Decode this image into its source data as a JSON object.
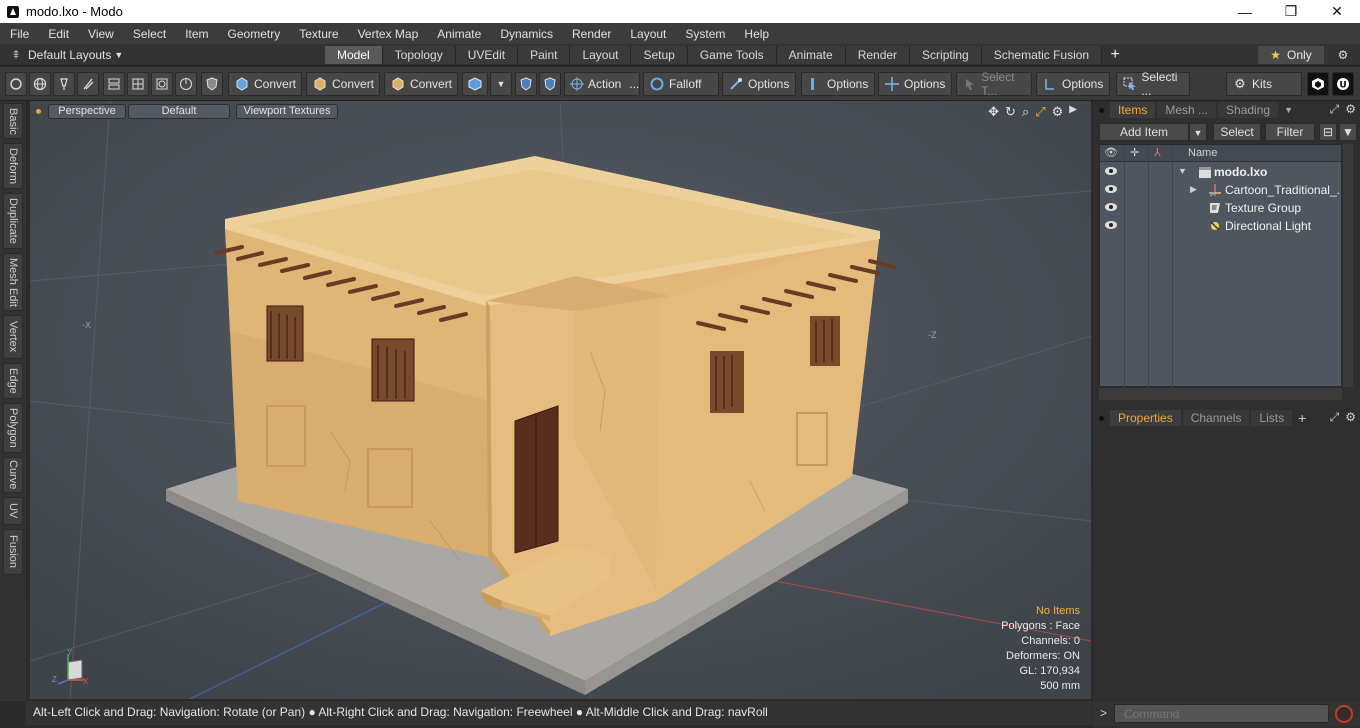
{
  "window": {
    "title": "modo.lxo - Modo",
    "minimize": "—",
    "maximize": "❐",
    "close": "✕"
  },
  "menu": [
    "File",
    "Edit",
    "View",
    "Select",
    "Item",
    "Geometry",
    "Texture",
    "Vertex Map",
    "Animate",
    "Dynamics",
    "Render",
    "Layout",
    "System",
    "Help"
  ],
  "layouts": {
    "dropdown_label": "Default Layouts",
    "tabs": [
      "Model",
      "Topology",
      "UVEdit",
      "Paint",
      "Layout",
      "Setup",
      "Game Tools",
      "Animate",
      "Render",
      "Scripting",
      "Schematic Fusion"
    ],
    "active_tab": "Model",
    "add": "+",
    "only_label": "Only"
  },
  "toolbar": {
    "convert1": "Convert",
    "convert2": "Convert",
    "convert3": "Convert",
    "action": "Action",
    "action_more": "...",
    "falloff": "Falloff",
    "options1": "Options",
    "options2": "Options",
    "options3": "Options",
    "options4": "Options",
    "select_t": "Select T...",
    "selecti": "Selecti ...",
    "kits": "Kits"
  },
  "left_tabs": [
    "Basic",
    "Deform",
    "Duplicate",
    "Mesh Edit",
    "Vertex",
    "Edge",
    "Polygon",
    "Curve",
    "UV",
    "Fusion"
  ],
  "viewport": {
    "view": "Perspective",
    "style": "Default",
    "shading": "Viewport Textures",
    "axis_x_label": "-X",
    "axis_z_label": "-Z",
    "info": {
      "selection": "No Items",
      "polygons": "Polygons : Face",
      "channels": "Channels: 0",
      "deformers": "Deformers: ON",
      "gl": "GL: 170,934",
      "scale": "500 mm"
    },
    "gizmo": {
      "y": "Y",
      "z": "Z",
      "x": "X"
    }
  },
  "status": {
    "hint1": "Alt-Left Click and Drag: Navigation: Rotate (or Pan)",
    "hint2": "Alt-Right Click and Drag: Navigation: Freewheel",
    "hint3": "Alt-Middle Click and Drag: navRoll"
  },
  "items_panel": {
    "tabs": [
      "Items",
      "Mesh ...",
      "Shading"
    ],
    "active_tab": "Items",
    "add_item": "Add Item",
    "select": "Select",
    "filter": "Filter",
    "column_name": "Name",
    "rows": [
      {
        "label": "modo.lxo",
        "bold": true
      },
      {
        "label": "Cartoon_Traditional_..."
      },
      {
        "label": "Texture Group"
      },
      {
        "label": "Directional Light"
      }
    ]
  },
  "properties_panel": {
    "tabs": [
      "Properties",
      "Channels",
      "Lists"
    ],
    "active_tab": "Properties",
    "add": "+"
  },
  "command": {
    "prompt": ">",
    "placeholder": "Command"
  },
  "colors": {
    "accent": "#f0a63a",
    "viewport_bg": "#4a4f57",
    "panel_bg": "#2f2f2f",
    "wall": "#e2b777",
    "wall_shade": "#d5a866",
    "base": "#a9a8a4",
    "door": "#5a2e1d"
  }
}
